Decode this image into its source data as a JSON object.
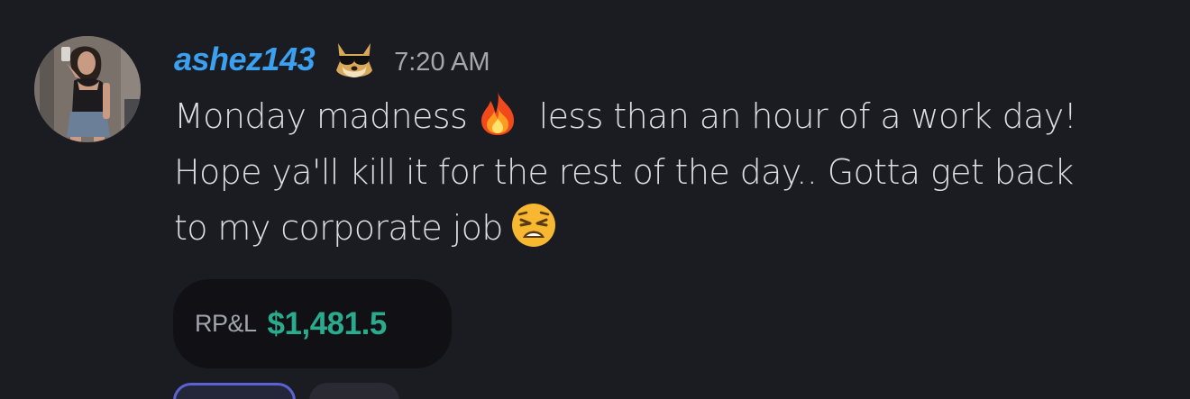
{
  "message": {
    "username": "ashez143",
    "badge_icon": "doge-sunglasses-icon",
    "timestamp": "7:20 AM",
    "avatar_icon": "user-avatar",
    "lines": [
      {
        "before": "Monday madness",
        "emoji": "fire-emoji",
        "after": " less than an hour of a work day!"
      },
      {
        "text": "Hope ya'll kill it for the rest of the day.. Gotta get back"
      },
      {
        "before": "to my corporate job",
        "emoji": "weary-face-emoji",
        "after": ""
      }
    ]
  },
  "pnl_card": {
    "label": "RP&L",
    "value": "$1,481.5",
    "value_color": "#2bab8e"
  },
  "colors": {
    "background": "#1b1b22",
    "username": "#3aa0ef",
    "text": "#dcdde2"
  }
}
